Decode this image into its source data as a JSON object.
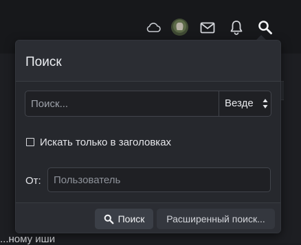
{
  "topbar": {
    "icons": [
      "cloud-icon",
      "avatar",
      "envelope-icon",
      "bell-icon",
      "search-icon"
    ]
  },
  "search_panel": {
    "title": "Поиск",
    "query_placeholder": "Поиск...",
    "scope_selected": "Везде",
    "titles_only_label": "Искать только в заголовках",
    "titles_only_checked": false,
    "from_label": "От:",
    "user_placeholder": "Пользователь",
    "search_button_label": "Поиск",
    "advanced_button_label": "Расширенный поиск..."
  },
  "background": {
    "partial_text": "...ному иши"
  }
}
